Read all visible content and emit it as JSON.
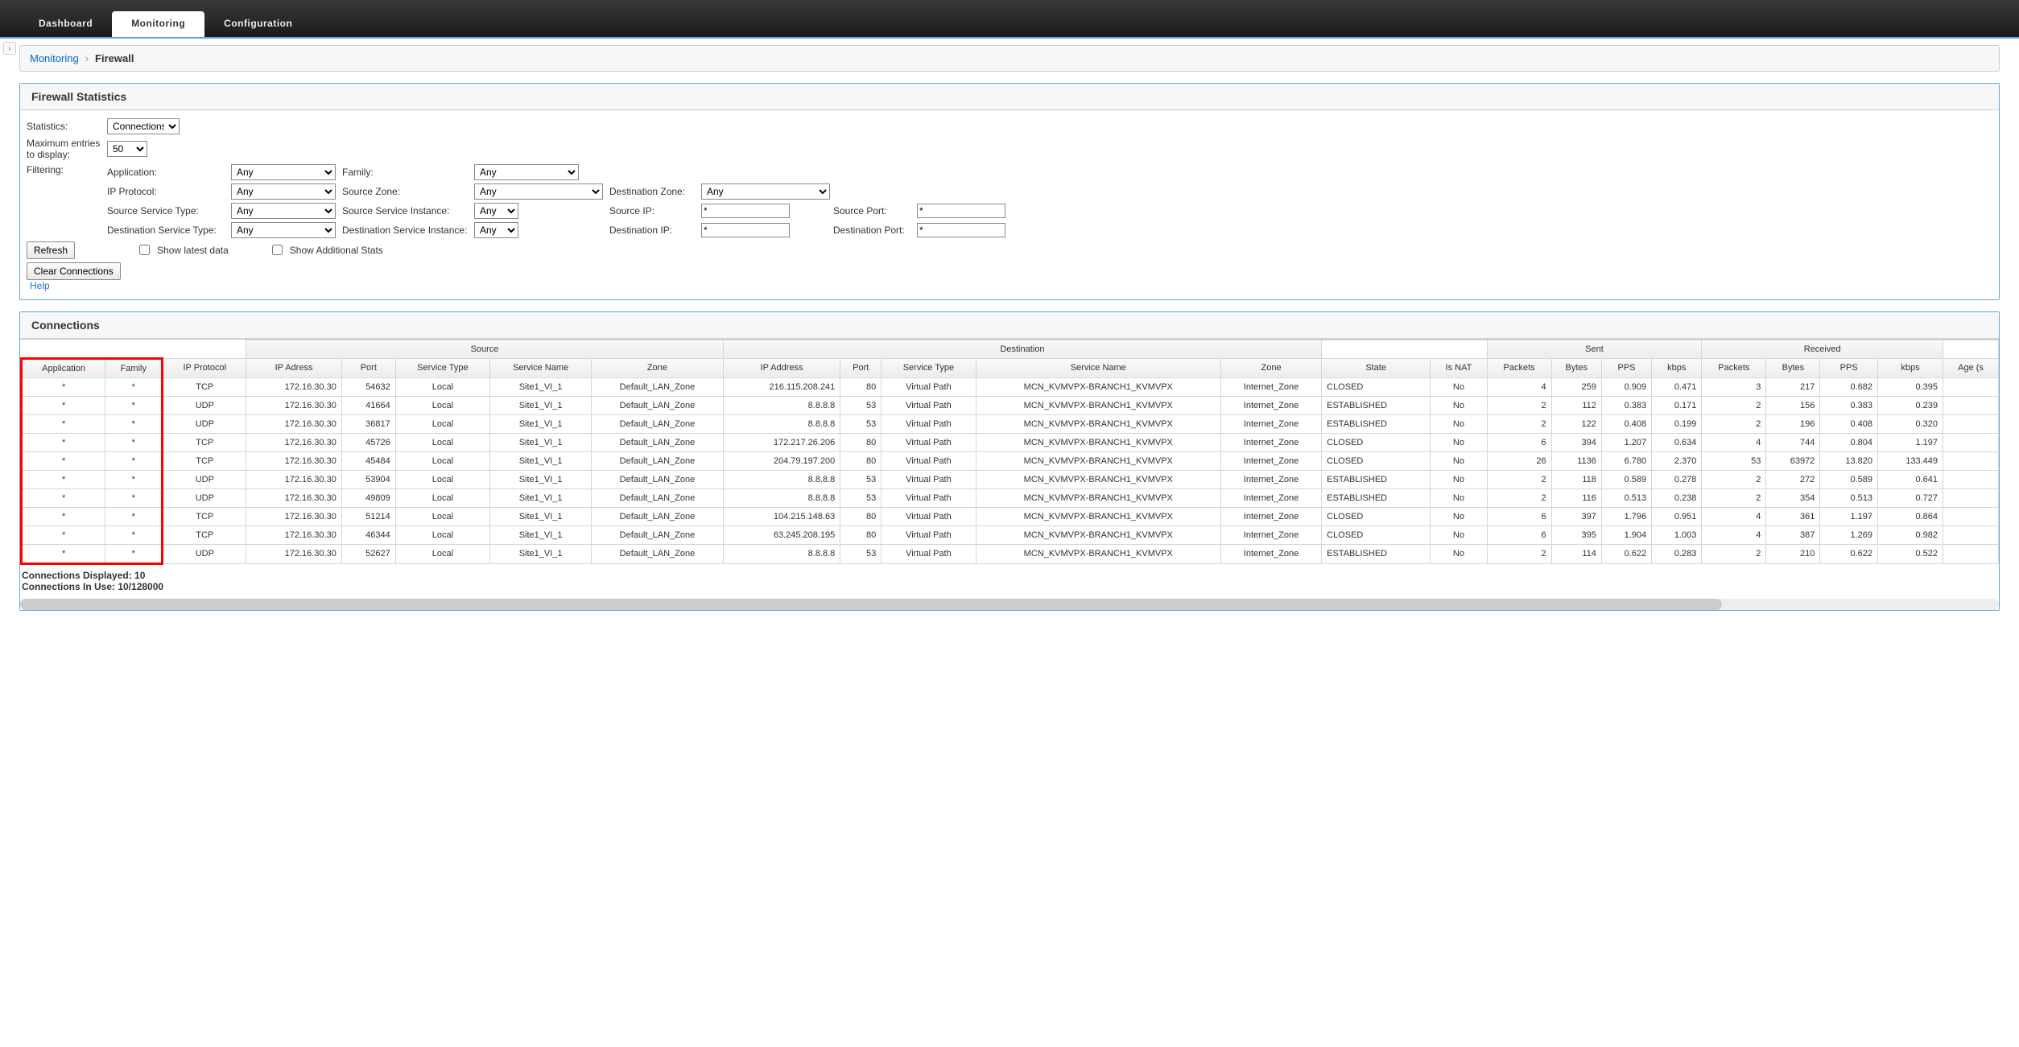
{
  "nav": {
    "tabs": [
      {
        "label": "Dashboard",
        "active": false
      },
      {
        "label": "Monitoring",
        "active": true
      },
      {
        "label": "Configuration",
        "active": false
      }
    ]
  },
  "breadcrumb": {
    "root": "Monitoring",
    "current": "Firewall"
  },
  "panel_title": "Firewall Statistics",
  "labels": {
    "statistics": "Statistics:",
    "max_entries": "Maximum entries to display:",
    "filtering": "Filtering:",
    "application": "Application:",
    "family": "Family:",
    "ip_protocol": "IP Protocol:",
    "source_zone": "Source Zone:",
    "dest_zone": "Destination Zone:",
    "source_service_type": "Source Service Type:",
    "source_service_instance": "Source Service Instance:",
    "source_ip": "Source IP:",
    "source_port": "Source Port:",
    "dest_service_type": "Destination Service Type:",
    "dest_service_instance": "Destination Service Instance:",
    "dest_ip": "Destination IP:",
    "dest_port": "Destination Port:",
    "show_latest": "Show latest data",
    "show_additional": "Show Additional Stats",
    "refresh": "Refresh",
    "clear": "Clear Connections",
    "help": "Help"
  },
  "selects": {
    "statistics": "Connections",
    "max_entries": "50",
    "application": "Any",
    "family": "Any",
    "ip_protocol": "Any",
    "source_zone": "Any",
    "dest_zone": "Any",
    "source_service_type": "Any",
    "source_service_instance": "Any",
    "dest_service_type": "Any",
    "dest_service_instance": "Any"
  },
  "inputs": {
    "source_ip": "*",
    "source_port": "*",
    "dest_ip": "*",
    "dest_port": "*"
  },
  "conn_title": "Connections",
  "groups": {
    "source": "Source",
    "destination": "Destination",
    "sent": "Sent",
    "received": "Received"
  },
  "columns": {
    "application": "Application",
    "family": "Family",
    "ip_protocol": "IP Protocol",
    "ip_address": "IP Adress",
    "port": "Port",
    "service_type": "Service Type",
    "service_name": "Service Name",
    "zone": "Zone",
    "dst_ip": "IP Address",
    "dst_port": "Port",
    "dst_service_type": "Service Type",
    "dst_service_name": "Service Name",
    "dst_zone": "Zone",
    "state": "State",
    "is_nat": "Is NAT",
    "packets": "Packets",
    "bytes": "Bytes",
    "pps": "PPS",
    "kbps": "kbps",
    "r_packets": "Packets",
    "r_bytes": "Bytes",
    "r_pps": "PPS",
    "r_kbps": "kbps",
    "age": "Age (s"
  },
  "rows": [
    {
      "app": "*",
      "fam": "*",
      "proto": "TCP",
      "sip": "172.16.30.30",
      "sport": "54632",
      "stype": "Local",
      "sname": "Site1_VI_1",
      "szone": "Default_LAN_Zone",
      "dip": "216.115.208.241",
      "dport": "80",
      "dtype": "Virtual Path",
      "dname": "MCN_KVMVPX-BRANCH1_KVMVPX",
      "dzone": "Internet_Zone",
      "state": "CLOSED",
      "nat": "No",
      "sp": "4",
      "sb": "259",
      "spps": "0.909",
      "skbps": "0.471",
      "rp": "3",
      "rb": "217",
      "rpps": "0.682",
      "rkbps": "0.395"
    },
    {
      "app": "*",
      "fam": "*",
      "proto": "UDP",
      "sip": "172.16.30.30",
      "sport": "41664",
      "stype": "Local",
      "sname": "Site1_VI_1",
      "szone": "Default_LAN_Zone",
      "dip": "8.8.8.8",
      "dport": "53",
      "dtype": "Virtual Path",
      "dname": "MCN_KVMVPX-BRANCH1_KVMVPX",
      "dzone": "Internet_Zone",
      "state": "ESTABLISHED",
      "nat": "No",
      "sp": "2",
      "sb": "112",
      "spps": "0.383",
      "skbps": "0.171",
      "rp": "2",
      "rb": "156",
      "rpps": "0.383",
      "rkbps": "0.239"
    },
    {
      "app": "*",
      "fam": "*",
      "proto": "UDP",
      "sip": "172.16.30.30",
      "sport": "36817",
      "stype": "Local",
      "sname": "Site1_VI_1",
      "szone": "Default_LAN_Zone",
      "dip": "8.8.8.8",
      "dport": "53",
      "dtype": "Virtual Path",
      "dname": "MCN_KVMVPX-BRANCH1_KVMVPX",
      "dzone": "Internet_Zone",
      "state": "ESTABLISHED",
      "nat": "No",
      "sp": "2",
      "sb": "122",
      "spps": "0.408",
      "skbps": "0.199",
      "rp": "2",
      "rb": "196",
      "rpps": "0.408",
      "rkbps": "0.320"
    },
    {
      "app": "*",
      "fam": "*",
      "proto": "TCP",
      "sip": "172.16.30.30",
      "sport": "45726",
      "stype": "Local",
      "sname": "Site1_VI_1",
      "szone": "Default_LAN_Zone",
      "dip": "172.217.26.206",
      "dport": "80",
      "dtype": "Virtual Path",
      "dname": "MCN_KVMVPX-BRANCH1_KVMVPX",
      "dzone": "Internet_Zone",
      "state": "CLOSED",
      "nat": "No",
      "sp": "6",
      "sb": "394",
      "spps": "1.207",
      "skbps": "0.634",
      "rp": "4",
      "rb": "744",
      "rpps": "0.804",
      "rkbps": "1.197"
    },
    {
      "app": "*",
      "fam": "*",
      "proto": "TCP",
      "sip": "172.16.30.30",
      "sport": "45484",
      "stype": "Local",
      "sname": "Site1_VI_1",
      "szone": "Default_LAN_Zone",
      "dip": "204.79.197.200",
      "dport": "80",
      "dtype": "Virtual Path",
      "dname": "MCN_KVMVPX-BRANCH1_KVMVPX",
      "dzone": "Internet_Zone",
      "state": "CLOSED",
      "nat": "No",
      "sp": "26",
      "sb": "1136",
      "spps": "6.780",
      "skbps": "2.370",
      "rp": "53",
      "rb": "63972",
      "rpps": "13.820",
      "rkbps": "133.449"
    },
    {
      "app": "*",
      "fam": "*",
      "proto": "UDP",
      "sip": "172.16.30.30",
      "sport": "53904",
      "stype": "Local",
      "sname": "Site1_VI_1",
      "szone": "Default_LAN_Zone",
      "dip": "8.8.8.8",
      "dport": "53",
      "dtype": "Virtual Path",
      "dname": "MCN_KVMVPX-BRANCH1_KVMVPX",
      "dzone": "Internet_Zone",
      "state": "ESTABLISHED",
      "nat": "No",
      "sp": "2",
      "sb": "118",
      "spps": "0.589",
      "skbps": "0.278",
      "rp": "2",
      "rb": "272",
      "rpps": "0.589",
      "rkbps": "0.641"
    },
    {
      "app": "*",
      "fam": "*",
      "proto": "UDP",
      "sip": "172.16.30.30",
      "sport": "49809",
      "stype": "Local",
      "sname": "Site1_VI_1",
      "szone": "Default_LAN_Zone",
      "dip": "8.8.8.8",
      "dport": "53",
      "dtype": "Virtual Path",
      "dname": "MCN_KVMVPX-BRANCH1_KVMVPX",
      "dzone": "Internet_Zone",
      "state": "ESTABLISHED",
      "nat": "No",
      "sp": "2",
      "sb": "116",
      "spps": "0.513",
      "skbps": "0.238",
      "rp": "2",
      "rb": "354",
      "rpps": "0.513",
      "rkbps": "0.727"
    },
    {
      "app": "*",
      "fam": "*",
      "proto": "TCP",
      "sip": "172.16.30.30",
      "sport": "51214",
      "stype": "Local",
      "sname": "Site1_VI_1",
      "szone": "Default_LAN_Zone",
      "dip": "104.215.148.63",
      "dport": "80",
      "dtype": "Virtual Path",
      "dname": "MCN_KVMVPX-BRANCH1_KVMVPX",
      "dzone": "Internet_Zone",
      "state": "CLOSED",
      "nat": "No",
      "sp": "6",
      "sb": "397",
      "spps": "1.796",
      "skbps": "0.951",
      "rp": "4",
      "rb": "361",
      "rpps": "1.197",
      "rkbps": "0.864"
    },
    {
      "app": "*",
      "fam": "*",
      "proto": "TCP",
      "sip": "172.16.30.30",
      "sport": "46344",
      "stype": "Local",
      "sname": "Site1_VI_1",
      "szone": "Default_LAN_Zone",
      "dip": "63.245.208.195",
      "dport": "80",
      "dtype": "Virtual Path",
      "dname": "MCN_KVMVPX-BRANCH1_KVMVPX",
      "dzone": "Internet_Zone",
      "state": "CLOSED",
      "nat": "No",
      "sp": "6",
      "sb": "395",
      "spps": "1.904",
      "skbps": "1.003",
      "rp": "4",
      "rb": "387",
      "rpps": "1.269",
      "rkbps": "0.982"
    },
    {
      "app": "*",
      "fam": "*",
      "proto": "UDP",
      "sip": "172.16.30.30",
      "sport": "52627",
      "stype": "Local",
      "sname": "Site1_VI_1",
      "szone": "Default_LAN_Zone",
      "dip": "8.8.8.8",
      "dport": "53",
      "dtype": "Virtual Path",
      "dname": "MCN_KVMVPX-BRANCH1_KVMVPX",
      "dzone": "Internet_Zone",
      "state": "ESTABLISHED",
      "nat": "No",
      "sp": "2",
      "sb": "114",
      "spps": "0.622",
      "skbps": "0.283",
      "rp": "2",
      "rb": "210",
      "rpps": "0.622",
      "rkbps": "0.522"
    }
  ],
  "summary": {
    "displayed": "Connections Displayed: 10",
    "inuse": "Connections In Use: 10/128000"
  }
}
